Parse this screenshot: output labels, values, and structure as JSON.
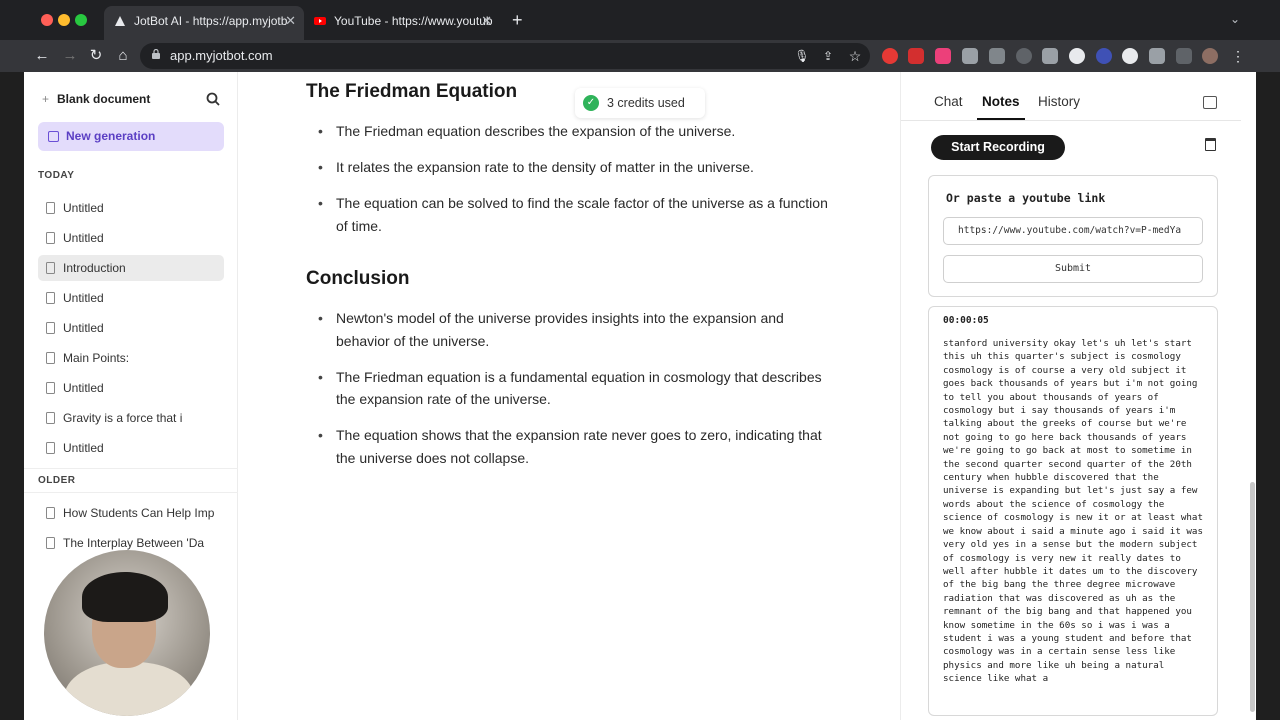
{
  "browser": {
    "tabs": [
      {
        "label": "JotBot AI - https://app.myjotb",
        "active": true
      },
      {
        "label": "YouTube - https://www.youtub",
        "active": false
      }
    ],
    "url": "app.myjotbot.com"
  },
  "sidebar": {
    "blank_document": "Blank document",
    "new_generation": "New generation",
    "today_label": "TODAY",
    "today_items": [
      "Untitled",
      "Untitled",
      "Introduction",
      "Untitled",
      "Untitled",
      "Main Points:",
      "Untitled",
      "Gravity is a force that i",
      "Untitled"
    ],
    "older_label": "OLDER",
    "older_items": [
      "How Students Can Help Imp",
      "The Interplay Between 'Da"
    ]
  },
  "toast": {
    "text": "3 credits used"
  },
  "document": {
    "sections": [
      {
        "heading": "The Friedman Equation",
        "bullets": [
          "The Friedman equation describes the expansion of the universe.",
          "It relates the expansion rate to the density of matter in the universe.",
          "The equation can be solved to find the scale factor of the universe as a function of time."
        ]
      },
      {
        "heading": "Conclusion",
        "bullets": [
          "Newton's model of the universe provides insights into the expansion and behavior of the universe.",
          "The Friedman equation is a fundamental equation in cosmology that describes the expansion rate of the universe.",
          "The equation shows that the expansion rate never goes to zero, indicating that the universe does not collapse."
        ]
      }
    ]
  },
  "right_panel": {
    "tabs": [
      "Chat",
      "Notes",
      "History"
    ],
    "active_tab": "Notes",
    "start_recording": "Start Recording",
    "youtube_title": "Or paste a youtube link",
    "youtube_value": "https://www.youtube.com/watch?v=P-medYa",
    "submit": "Submit",
    "timestamp": "00:00:05",
    "transcript": "stanford university okay let's uh let's start this uh this quarter's subject is cosmology cosmology is of course a very old subject it goes back thousands of years but i'm not going to tell you about thousands of years of cosmology but i say thousands of years i'm talking about the greeks of course but we're not going to go here back thousands of years we're going to go back at most to sometime in the second quarter second quarter of the 20th century when hubble discovered that the universe is expanding but let's just say a few words about the science of cosmology the science of cosmology is new it or at least what we know about i said a minute ago i said it was very old yes in a sense but the modern subject of cosmology is very new it really dates to well after hubble it dates um to the discovery of the big bang the three degree microwave radiation that was discovered as uh as the remnant of the big bang and that happened you know sometime in the 60s so i was i was a student i was a young student and before that cosmology was in a certain sense less like physics and more like uh being a natural science like what a"
  },
  "colors": {
    "accent": "#e3dcfb",
    "accent_text": "#5b3fc4",
    "success": "#2fb35a"
  }
}
